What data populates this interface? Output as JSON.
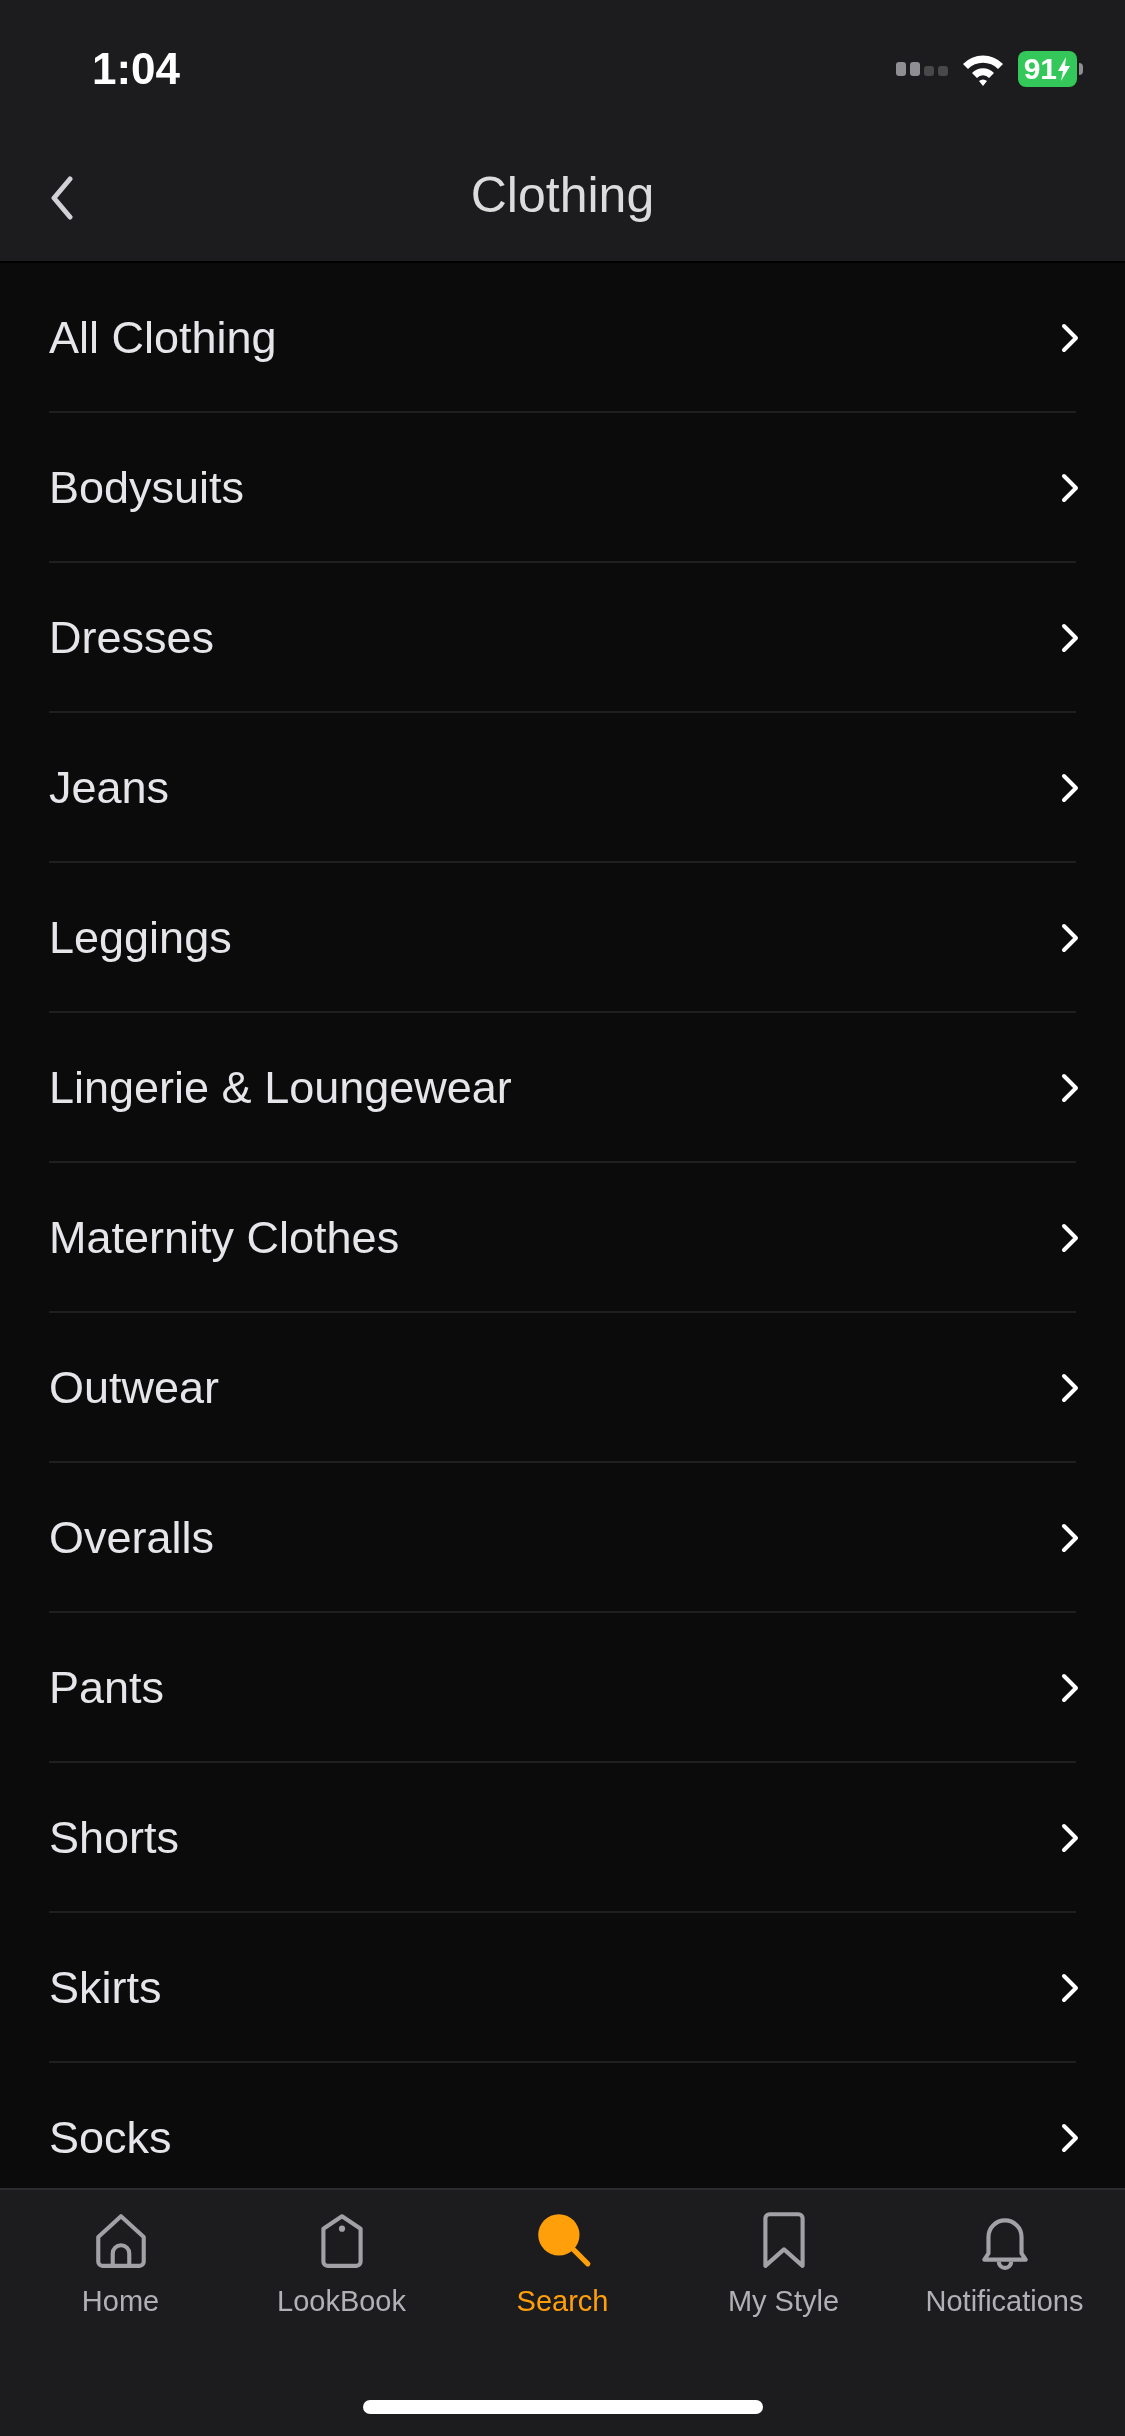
{
  "status_bar": {
    "time": "1:04",
    "battery": "91"
  },
  "nav": {
    "title": "Clothing"
  },
  "categories": [
    {
      "label": "All Clothing"
    },
    {
      "label": "Bodysuits"
    },
    {
      "label": "Dresses"
    },
    {
      "label": "Jeans"
    },
    {
      "label": "Leggings"
    },
    {
      "label": "Lingerie & Loungewear"
    },
    {
      "label": "Maternity Clothes"
    },
    {
      "label": "Outwear"
    },
    {
      "label": "Overalls"
    },
    {
      "label": "Pants"
    },
    {
      "label": "Shorts"
    },
    {
      "label": "Skirts"
    },
    {
      "label": "Socks"
    }
  ],
  "tab_bar": [
    {
      "kind": "home",
      "label": "Home",
      "selected": false
    },
    {
      "kind": "tag",
      "label": "LookBook",
      "selected": false
    },
    {
      "kind": "search",
      "label": "Search",
      "selected": true
    },
    {
      "kind": "bookmark",
      "label": "My Style",
      "selected": false
    },
    {
      "kind": "bell",
      "label": "Notifications",
      "selected": false
    }
  ]
}
